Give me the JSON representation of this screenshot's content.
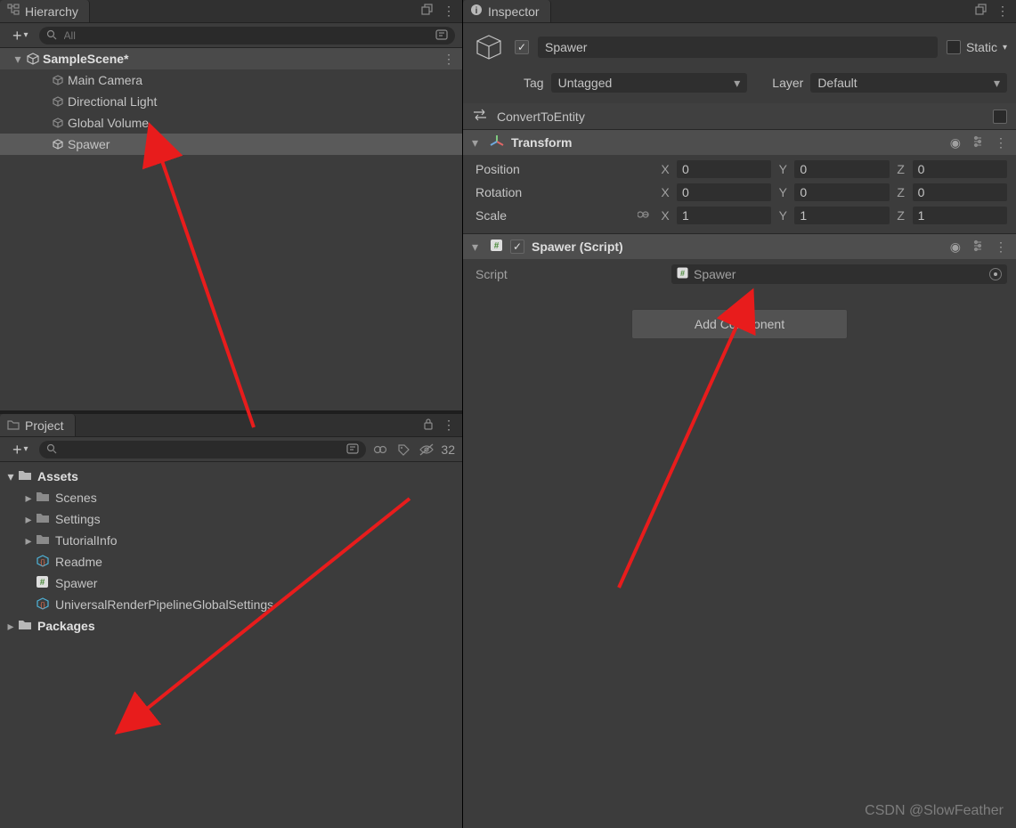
{
  "hierarchy": {
    "tab_label": "Hierarchy",
    "search_placeholder": "All",
    "scene_name": "SampleScene*",
    "items": [
      {
        "label": "Main Camera"
      },
      {
        "label": "Directional Light"
      },
      {
        "label": "Global Volume"
      },
      {
        "label": "Spawer"
      }
    ]
  },
  "project": {
    "tab_label": "Project",
    "search_placeholder": "",
    "hidden_count": "32",
    "tree": {
      "assets_label": "Assets",
      "assets_children": [
        {
          "type": "folder",
          "label": "Scenes"
        },
        {
          "type": "folder",
          "label": "Settings"
        },
        {
          "type": "folder",
          "label": "TutorialInfo"
        },
        {
          "type": "cube",
          "label": "Readme"
        },
        {
          "type": "script",
          "label": "Spawer"
        },
        {
          "type": "cube",
          "label": "UniversalRenderPipelineGlobalSettings"
        }
      ],
      "packages_label": "Packages"
    }
  },
  "inspector": {
    "tab_label": "Inspector",
    "object_name": "Spawer",
    "static_label": "Static",
    "tag_label": "Tag",
    "tag_value": "Untagged",
    "layer_label": "Layer",
    "layer_value": "Default",
    "convert_label": "ConvertToEntity",
    "transform": {
      "title": "Transform",
      "position_label": "Position",
      "rotation_label": "Rotation",
      "scale_label": "Scale",
      "axes": [
        "X",
        "Y",
        "Z"
      ],
      "position": [
        "0",
        "0",
        "0"
      ],
      "rotation": [
        "0",
        "0",
        "0"
      ],
      "scale": [
        "1",
        "1",
        "1"
      ]
    },
    "script_component": {
      "title": "Spawer (Script)",
      "field_label": "Script",
      "field_value": "Spawer"
    },
    "add_component_label": "Add Component"
  },
  "watermark": "CSDN @SlowFeather"
}
